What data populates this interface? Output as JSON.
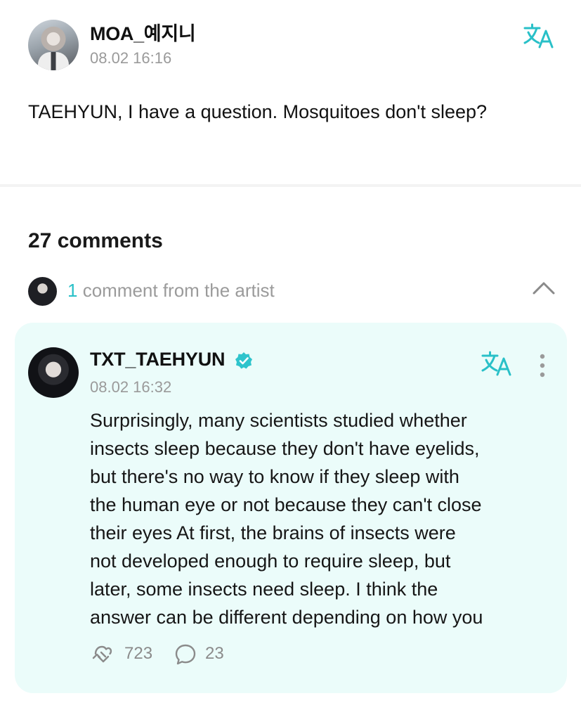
{
  "post": {
    "author": "MOA_예지니",
    "time": "08.02 16:16",
    "body": "TAEHYUN, I have a question. Mosquitoes don't sleep?"
  },
  "comments": {
    "count_label": "27 comments",
    "artist_count": "1",
    "artist_label": " comment from the artist"
  },
  "artist_comment": {
    "author": "TXT_TAEHYUN",
    "time": "08.02 16:32",
    "body": "Surprisingly, many scientists studied whether\ninsects sleep because they don't have eyelids,\nbut there's no way to know if they sleep with\nthe human eye or not because they can't close\ntheir eyes At first, the brains of insects were\nnot developed enough to require sleep, but\nlater, some insects need sleep. I think the\nanswer can be different depending on how you",
    "likes": "723",
    "replies": "23"
  },
  "icons": {
    "translate": "translate-icon",
    "verified": "verified-badge-icon",
    "more": "more-vertical-icon",
    "chevron": "chevron-up-icon",
    "like": "like-icon",
    "reply": "speech-bubble-icon"
  },
  "colors": {
    "accent": "#29c0c8",
    "card_background": "#ebfcfa",
    "muted_text": "#9a9a9a"
  }
}
